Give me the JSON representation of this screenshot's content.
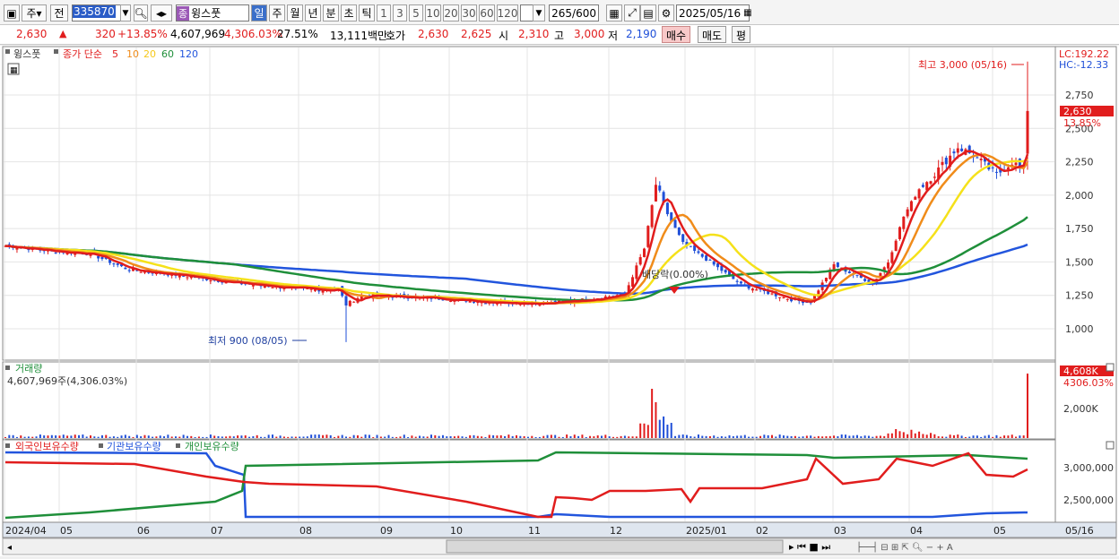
{
  "toolbar": {
    "type_label": "주",
    "prev_label": "전",
    "code_value": "335870",
    "stock_name": "윙스풋",
    "stock_tag": "종",
    "periods": [
      "일",
      "주",
      "월",
      "년",
      "분",
      "초",
      "틱"
    ],
    "active_period": "일",
    "intervals": [
      "1",
      "3",
      "5",
      "10",
      "20",
      "30",
      "60",
      "120"
    ],
    "count": "265",
    "count_total": "/600",
    "date": "2025/05/16"
  },
  "info": {
    "price": "2,630",
    "arrow": "▲",
    "change": "320",
    "change_pct": "+13.85%",
    "volume": "4,607,969",
    "volume_pct": "4,306.03%",
    "turnover": "27.51%",
    "amount": "13,111백만",
    "bid_label": "호가",
    "bid1": "2,630",
    "bid2": "2,625",
    "open_label": "시",
    "open": "2,310",
    "high_label": "고",
    "high": "3,000",
    "low_label": "저",
    "low": "2,190",
    "buy_label": "매수",
    "sell_label": "매도",
    "eval_label": "평"
  },
  "price_panel": {
    "stock_name": "윙스풋",
    "ma_title": "종가 단순",
    "ma_periods": [
      "5",
      "10",
      "20",
      "60",
      "120"
    ],
    "lc": "LC:192.22",
    "hc": "HC:-12.33",
    "y_ticks": [
      "2,750",
      "2,500",
      "2,250",
      "2,000",
      "1,750",
      "1,500",
      "1,250",
      "1,000"
    ],
    "current_price_tag": "2,630",
    "current_pct_tag": "13.85%",
    "high_annotation": "최고 3,000 (05/16)",
    "low_annotation": "최저 900 (08/05)",
    "dividend_annotation": "배당락(0.00%)"
  },
  "volume_panel": {
    "title": "거래량",
    "value_label": "4,607,969주(4,306.03%)",
    "tag_value": "4,608K",
    "tag_pct": "4306.03%",
    "y_tick": "2,000K"
  },
  "holdings_panel": {
    "legend": [
      "외국인보유수량",
      "기관보유수량",
      "개인보유수량"
    ],
    "y_ticks": [
      "3,000,000",
      "2,500,000"
    ]
  },
  "x_axis": [
    "2024/04",
    "05",
    "06",
    "07",
    "08",
    "09",
    "10",
    "11",
    "12",
    "2025/01",
    "02",
    "03",
    "04",
    "05",
    "05/16"
  ],
  "colors": {
    "ma5": "#e11d1d",
    "ma10": "#f08c1a",
    "ma20": "#f5e11a",
    "ma60": "#1f8f3a",
    "ma120": "#2255dd",
    "up": "#e11d1d",
    "down": "#1f4fd8"
  }
}
